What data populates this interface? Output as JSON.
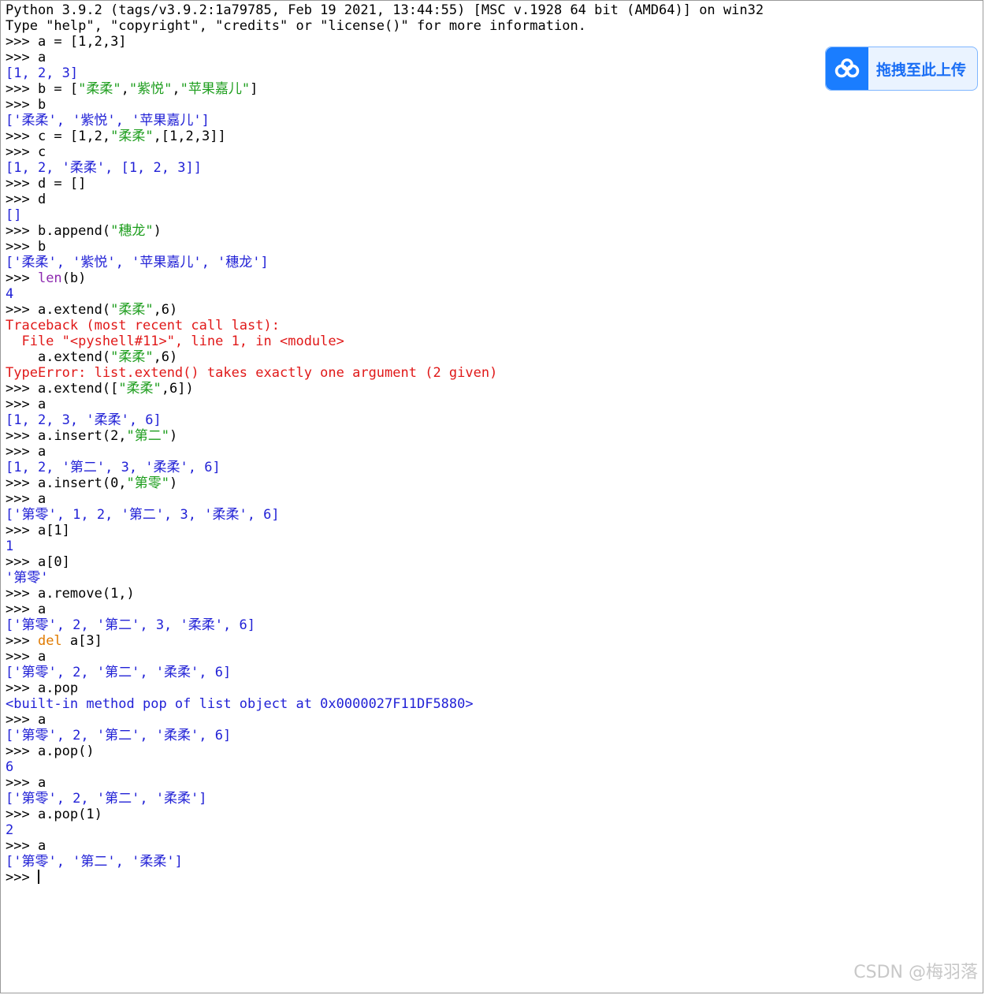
{
  "console": {
    "lines": [
      [
        {
          "c": "plain",
          "t": "Python 3.9.2 (tags/v3.9.2:1a79785, Feb 19 2021, 13:44:55) [MSC v.1928 64 bit (AMD64)] on win32"
        }
      ],
      [
        {
          "c": "plain",
          "t": "Type \"help\", \"copyright\", \"credits\" or \"license()\" for more information."
        }
      ],
      [
        {
          "c": "prompt",
          "t": ">>> "
        },
        {
          "c": "plain",
          "t": "a = [1,2,3]"
        }
      ],
      [
        {
          "c": "prompt",
          "t": ">>> "
        },
        {
          "c": "plain",
          "t": "a"
        }
      ],
      [
        {
          "c": "out",
          "t": "[1, 2, 3]"
        }
      ],
      [
        {
          "c": "prompt",
          "t": ">>> "
        },
        {
          "c": "plain",
          "t": "b = ["
        },
        {
          "c": "str",
          "t": "\"柔柔\""
        },
        {
          "c": "plain",
          "t": ","
        },
        {
          "c": "str",
          "t": "\"紫悦\""
        },
        {
          "c": "plain",
          "t": ","
        },
        {
          "c": "str",
          "t": "\"苹果嘉儿\""
        },
        {
          "c": "plain",
          "t": "]"
        }
      ],
      [
        {
          "c": "prompt",
          "t": ">>> "
        },
        {
          "c": "plain",
          "t": "b"
        }
      ],
      [
        {
          "c": "out",
          "t": "['柔柔', '紫悦', '苹果嘉儿']"
        }
      ],
      [
        {
          "c": "prompt",
          "t": ">>> "
        },
        {
          "c": "plain",
          "t": "c = [1,2,"
        },
        {
          "c": "str",
          "t": "\"柔柔\""
        },
        {
          "c": "plain",
          "t": ",[1,2,3]]"
        }
      ],
      [
        {
          "c": "prompt",
          "t": ">>> "
        },
        {
          "c": "plain",
          "t": "c"
        }
      ],
      [
        {
          "c": "out",
          "t": "[1, 2, '柔柔', [1, 2, 3]]"
        }
      ],
      [
        {
          "c": "prompt",
          "t": ">>> "
        },
        {
          "c": "plain",
          "t": "d = []"
        }
      ],
      [
        {
          "c": "prompt",
          "t": ">>> "
        },
        {
          "c": "plain",
          "t": "d"
        }
      ],
      [
        {
          "c": "out",
          "t": "[]"
        }
      ],
      [
        {
          "c": "prompt",
          "t": ">>> "
        },
        {
          "c": "plain",
          "t": "b.append("
        },
        {
          "c": "str",
          "t": "\"穗龙\""
        },
        {
          "c": "plain",
          "t": ")"
        }
      ],
      [
        {
          "c": "prompt",
          "t": ">>> "
        },
        {
          "c": "plain",
          "t": "b"
        }
      ],
      [
        {
          "c": "out",
          "t": "['柔柔', '紫悦', '苹果嘉儿', '穗龙']"
        }
      ],
      [
        {
          "c": "prompt",
          "t": ">>> "
        },
        {
          "c": "builtin",
          "t": "len"
        },
        {
          "c": "plain",
          "t": "(b)"
        }
      ],
      [
        {
          "c": "out",
          "t": "4"
        }
      ],
      [
        {
          "c": "prompt",
          "t": ">>> "
        },
        {
          "c": "plain",
          "t": "a.extend("
        },
        {
          "c": "str",
          "t": "\"柔柔\""
        },
        {
          "c": "plain",
          "t": ",6)"
        }
      ],
      [
        {
          "c": "err",
          "t": "Traceback (most recent call last):"
        }
      ],
      [
        {
          "c": "err",
          "t": "  File \"<pyshell#11>\", line 1, in <module>"
        }
      ],
      [
        {
          "c": "err",
          "t": "    "
        },
        {
          "c": "plain",
          "t": "a.extend("
        },
        {
          "c": "str",
          "t": "\"柔柔\""
        },
        {
          "c": "plain",
          "t": ",6)"
        }
      ],
      [
        {
          "c": "err",
          "t": "TypeError: list.extend() takes exactly one argument (2 given)"
        }
      ],
      [
        {
          "c": "prompt",
          "t": ">>> "
        },
        {
          "c": "plain",
          "t": "a.extend(["
        },
        {
          "c": "str",
          "t": "\"柔柔\""
        },
        {
          "c": "plain",
          "t": ",6])"
        }
      ],
      [
        {
          "c": "prompt",
          "t": ">>> "
        },
        {
          "c": "plain",
          "t": "a"
        }
      ],
      [
        {
          "c": "out",
          "t": "[1, 2, 3, '柔柔', 6]"
        }
      ],
      [
        {
          "c": "prompt",
          "t": ">>> "
        },
        {
          "c": "plain",
          "t": "a.insert(2,"
        },
        {
          "c": "str",
          "t": "\"第二\""
        },
        {
          "c": "plain",
          "t": ")"
        }
      ],
      [
        {
          "c": "prompt",
          "t": ">>> "
        },
        {
          "c": "plain",
          "t": "a"
        }
      ],
      [
        {
          "c": "out",
          "t": "[1, 2, '第二', 3, '柔柔', 6]"
        }
      ],
      [
        {
          "c": "prompt",
          "t": ">>> "
        },
        {
          "c": "plain",
          "t": "a.insert(0,"
        },
        {
          "c": "str",
          "t": "\"第零\""
        },
        {
          "c": "plain",
          "t": ")"
        }
      ],
      [
        {
          "c": "prompt",
          "t": ">>> "
        },
        {
          "c": "plain",
          "t": "a"
        }
      ],
      [
        {
          "c": "out",
          "t": "['第零', 1, 2, '第二', 3, '柔柔', 6]"
        }
      ],
      [
        {
          "c": "prompt",
          "t": ">>> "
        },
        {
          "c": "plain",
          "t": "a[1]"
        }
      ],
      [
        {
          "c": "out",
          "t": "1"
        }
      ],
      [
        {
          "c": "prompt",
          "t": ">>> "
        },
        {
          "c": "plain",
          "t": "a[0]"
        }
      ],
      [
        {
          "c": "out",
          "t": "'第零'"
        }
      ],
      [
        {
          "c": "prompt",
          "t": ">>> "
        },
        {
          "c": "plain",
          "t": "a.remove(1,)"
        }
      ],
      [
        {
          "c": "prompt",
          "t": ">>> "
        },
        {
          "c": "plain",
          "t": "a"
        }
      ],
      [
        {
          "c": "out",
          "t": "['第零', 2, '第二', 3, '柔柔', 6]"
        }
      ],
      [
        {
          "c": "prompt",
          "t": ">>> "
        },
        {
          "c": "kw",
          "t": "del"
        },
        {
          "c": "plain",
          "t": " a[3]"
        }
      ],
      [
        {
          "c": "prompt",
          "t": ">>> "
        },
        {
          "c": "plain",
          "t": "a"
        }
      ],
      [
        {
          "c": "out",
          "t": "['第零', 2, '第二', '柔柔', 6]"
        }
      ],
      [
        {
          "c": "prompt",
          "t": ">>> "
        },
        {
          "c": "plain",
          "t": "a.pop"
        }
      ],
      [
        {
          "c": "out",
          "t": "<built-in method pop of list object at 0x0000027F11DF5880>"
        }
      ],
      [
        {
          "c": "prompt",
          "t": ">>> "
        },
        {
          "c": "plain",
          "t": "a"
        }
      ],
      [
        {
          "c": "out",
          "t": "['第零', 2, '第二', '柔柔', 6]"
        }
      ],
      [
        {
          "c": "prompt",
          "t": ">>> "
        },
        {
          "c": "plain",
          "t": "a.pop()"
        }
      ],
      [
        {
          "c": "out",
          "t": "6"
        }
      ],
      [
        {
          "c": "prompt",
          "t": ">>> "
        },
        {
          "c": "plain",
          "t": "a"
        }
      ],
      [
        {
          "c": "out",
          "t": "['第零', 2, '第二', '柔柔']"
        }
      ],
      [
        {
          "c": "prompt",
          "t": ">>> "
        },
        {
          "c": "plain",
          "t": "a.pop(1)"
        }
      ],
      [
        {
          "c": "out",
          "t": "2"
        }
      ],
      [
        {
          "c": "prompt",
          "t": ">>> "
        },
        {
          "c": "plain",
          "t": "a"
        }
      ],
      [
        {
          "c": "out",
          "t": "['第零', '第二', '柔柔']"
        }
      ],
      [
        {
          "c": "prompt",
          "t": ">>> "
        },
        {
          "c": "caret",
          "t": ""
        }
      ]
    ]
  },
  "upload_widget": {
    "label": "拖拽至此上传",
    "icon": "cloud-upload-icon"
  },
  "watermark": {
    "text": "CSDN @梅羽落"
  },
  "colors": {
    "prompt": "#000000",
    "output": "#2121d6",
    "string": "#1e9e1e",
    "error": "#e01818",
    "keyword": "#e07a00",
    "builtin": "#8e2bb0",
    "upload_accent": "#1a7dff"
  }
}
